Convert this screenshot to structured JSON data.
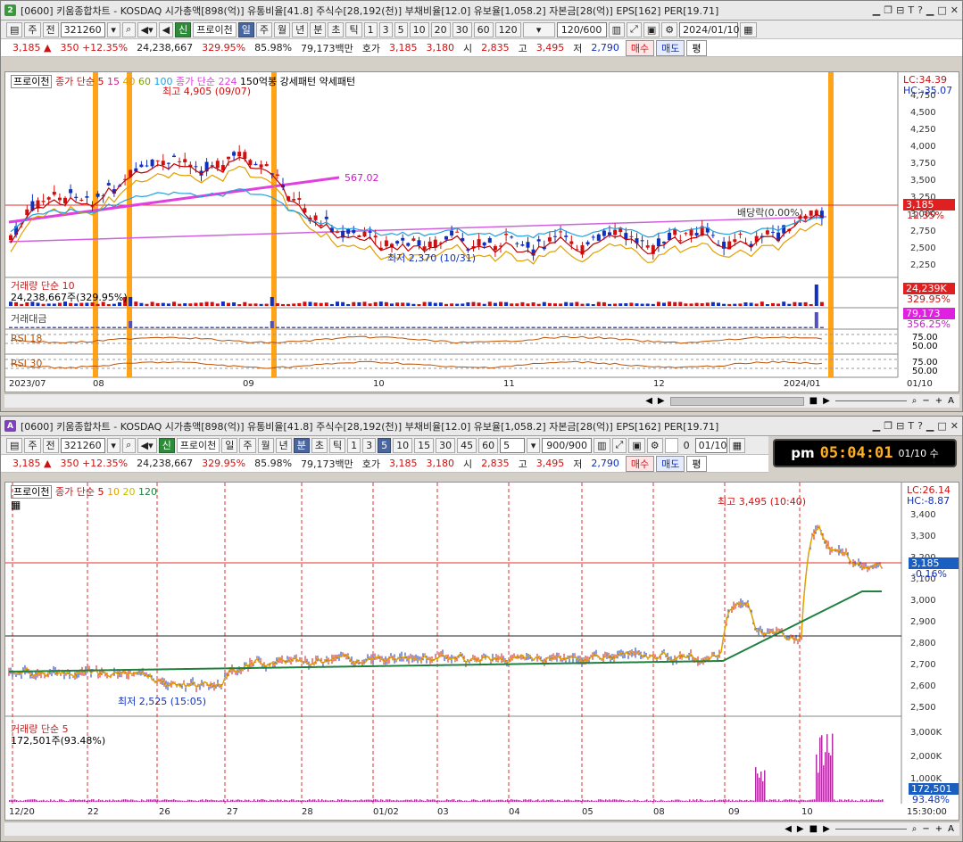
{
  "colors": {
    "up": "#d01010",
    "down": "#1030c0",
    "orange": "#ff9900",
    "magenta": "#e040e0"
  },
  "win1": {
    "badge": "2",
    "title": "[0600] 키움종합차트 - KOSDAQ 시가총액[898(억)] 유통비율[41.8] 주식수[28,192(천)] 부채비율[12.0] 유보율[1,058.2] 자본금[28(억)] EPS[162] PER[19.71]",
    "controls": [
      "ㅡ",
      "□",
      "ꟷ",
      "T",
      "?",
      "ㅡ",
      "□",
      "✕"
    ],
    "toolbar": {
      "type": "주",
      "all": "전",
      "code": "321260",
      "new": "신",
      "broker": "프로이천",
      "periods": [
        "일",
        "주",
        "월",
        "년",
        "분",
        "초",
        "틱"
      ],
      "nums": [
        "1",
        "3",
        "5",
        "10",
        "20",
        "30",
        "60",
        "120"
      ],
      "count": "120/600",
      "date": "2024/01/10"
    },
    "quote": {
      "price": "3,185",
      "arrow": "▲",
      "change": "350",
      "pct": "+12.35%",
      "volume": "24,238,667",
      "vol_pct": "329.95%",
      "ratio": "85.98%",
      "amount": "79,173백만",
      "hoga": "호가",
      "ask": "3,185",
      "bid": "3,180",
      "open_lbl": "시",
      "open": "2,835",
      "high_lbl": "고",
      "high": "3,495",
      "low_lbl": "저",
      "low": "2,790",
      "buy": "매수",
      "sell": "매도",
      "avg": "평"
    },
    "legend": {
      "broker": "프로이천",
      "ma_label": "종가 단순",
      "ma": [
        "5",
        "15",
        "40",
        "60",
        "100"
      ],
      "ma2": "종가 단순 224",
      "pattern": "150억봉 강세패턴 약세패턴"
    },
    "annot": {
      "high": "최고 4,905 (09/07)",
      "low": "최저 2,370 (10/31)",
      "level": "567.02",
      "div": "배당락(0.00%)"
    },
    "price_axis": [
      "4,750",
      "4,500",
      "4,250",
      "4,000",
      "3,750",
      "3,500",
      "3,250",
      "3,000",
      "2,750",
      "2,500",
      "2,250"
    ],
    "lc": "LC:34.39",
    "hc": "HC:-35.07",
    "price_tag": "3,185",
    "pct_tag": "12.35%",
    "vol_legend": "거래량  단순 10",
    "vol_value": "24,238,667주(329.95%)",
    "vol_tag": "24,239K",
    "vol_pct_tag": "329.95%",
    "amt_legend": "거래대금",
    "amt_tag": "79,173",
    "amt_pct_tag": "356.25%",
    "rsi1": "RSI 18",
    "rsi2": "RSI 30",
    "rsi_vals": [
      "75.00",
      "50.00"
    ],
    "xaxis": [
      "2023/07",
      "08",
      "09",
      "10",
      "11",
      "12",
      "2024/01",
      "01/10"
    ]
  },
  "win2": {
    "badge": "A",
    "title": "[0600] 키움종합차트 - KOSDAQ 시가총액[898(억)] 유통비율[41.8] 주식수[28,192(천)] 부채비율[12.0] 유보율[1,058.2] 자본금[28(억)] EPS[162] PER[19.71]",
    "controls": [
      "ㅡ",
      "□",
      "ꟷ",
      "T",
      "?",
      "ㅡ",
      "□",
      "✕"
    ],
    "toolbar": {
      "type": "주",
      "all": "전",
      "code": "321260",
      "new": "신",
      "broker": "프로이천",
      "periods": [
        "일",
        "주",
        "월",
        "년",
        "분",
        "초",
        "틱"
      ],
      "nums": [
        "1",
        "3",
        "5",
        "10",
        "15",
        "30",
        "45",
        "60"
      ],
      "sel_num": "5",
      "count": "900/900",
      "check": "0",
      "date": "01/10"
    },
    "clock": {
      "ampm": "pm",
      "time": "05:04:01",
      "date": "01/10 수"
    },
    "quote": {
      "price": "3,185",
      "arrow": "▲",
      "change": "350",
      "pct": "+12.35%",
      "volume": "24,238,667",
      "vol_pct": "329.95%",
      "ratio": "85.98%",
      "amount": "79,173백만",
      "hoga": "호가",
      "ask": "3,185",
      "bid": "3,180",
      "open_lbl": "시",
      "open": "2,835",
      "high_lbl": "고",
      "high": "3,495",
      "low_lbl": "저",
      "low": "2,790",
      "buy": "매수",
      "sell": "매도",
      "avg": "평"
    },
    "legend": {
      "broker": "프로이천",
      "ma_label": "종가 단순",
      "ma": [
        "5",
        "10",
        "20",
        "120"
      ]
    },
    "annot": {
      "high": "최고 3,495 (10:40)",
      "low": "최저 2,525 (15:05)"
    },
    "price_axis": [
      "3,400",
      "3,300",
      "3,200",
      "3,100",
      "3,000",
      "2,900",
      "2,800",
      "2,700",
      "2,600",
      "2,500"
    ],
    "lc": "LC:26.14",
    "hc": "HC:-8.87",
    "price_tag": "3,185",
    "pct_tag": "-0.16%",
    "vol_legend": "거래량  단순 5",
    "vol_value": "172,501주(93.48%)",
    "vol_axis": [
      "3,000K",
      "2,000K",
      "1,000K"
    ],
    "vol_tag": "172,501",
    "vol_pct_tag": "93.48%",
    "xaxis": [
      "12/20",
      "22",
      "26",
      "27",
      "28",
      "01/02",
      "03",
      "04",
      "05",
      "08",
      "09",
      "10",
      "15:30:00"
    ]
  }
}
